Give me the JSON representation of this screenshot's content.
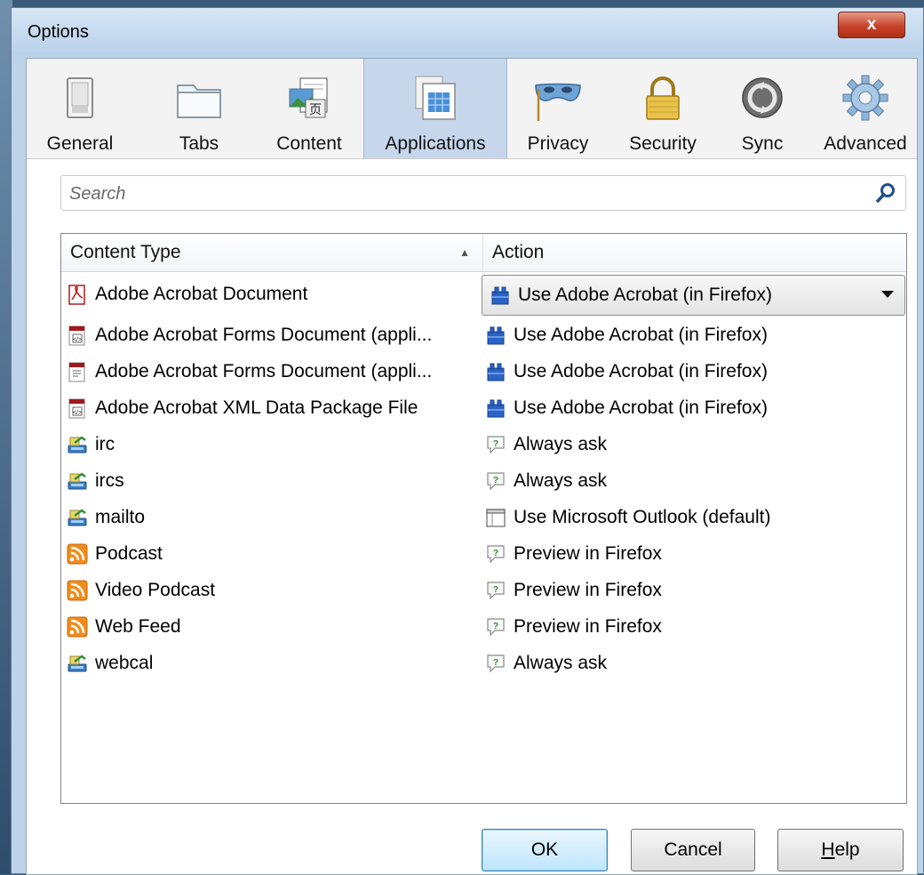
{
  "window": {
    "title": "Options",
    "close_label": "x"
  },
  "toolbar": {
    "items": [
      {
        "label": "General",
        "icon": "switch-icon"
      },
      {
        "label": "Tabs",
        "icon": "folder-tabs-icon"
      },
      {
        "label": "Content",
        "icon": "content-icon"
      },
      {
        "label": "Applications",
        "icon": "applications-icon",
        "selected": true
      },
      {
        "label": "Privacy",
        "icon": "mask-icon"
      },
      {
        "label": "Security",
        "icon": "padlock-icon"
      },
      {
        "label": "Sync",
        "icon": "sync-icon"
      },
      {
        "label": "Advanced",
        "icon": "gear-icon"
      }
    ]
  },
  "search": {
    "placeholder": "Search",
    "value": ""
  },
  "table": {
    "columns": {
      "content_type": "Content Type",
      "action": "Action"
    },
    "rows": [
      {
        "type": "Adobe Acrobat Document",
        "type_icon": "pdf-icon",
        "action": "Use Adobe Acrobat (in Firefox)",
        "action_icon": "acrobat-plugin-icon",
        "selected": true
      },
      {
        "type": "Adobe Acrobat Forms Document (appli...",
        "type_icon": "acrobat-forms-icon",
        "action": "Use Adobe Acrobat (in Firefox)",
        "action_icon": "acrobat-plugin-icon"
      },
      {
        "type": "Adobe Acrobat Forms Document (appli...",
        "type_icon": "acrobat-forms-doc-icon",
        "action": "Use Adobe Acrobat (in Firefox)",
        "action_icon": "acrobat-plugin-icon"
      },
      {
        "type": "Adobe Acrobat XML Data Package File",
        "type_icon": "acrobat-xml-icon",
        "action": "Use Adobe Acrobat (in Firefox)",
        "action_icon": "acrobat-plugin-icon"
      },
      {
        "type": "irc",
        "type_icon": "protocol-icon",
        "action": "Always ask",
        "action_icon": "ask-icon"
      },
      {
        "type": "ircs",
        "type_icon": "protocol-icon",
        "action": "Always ask",
        "action_icon": "ask-icon"
      },
      {
        "type": "mailto",
        "type_icon": "protocol-icon",
        "action": "Use Microsoft Outlook (default)",
        "action_icon": "application-icon"
      },
      {
        "type": "Podcast",
        "type_icon": "feed-icon",
        "action": "Preview in Firefox",
        "action_icon": "ask-icon"
      },
      {
        "type": "Video Podcast",
        "type_icon": "feed-icon",
        "action": "Preview in Firefox",
        "action_icon": "ask-icon"
      },
      {
        "type": "Web Feed",
        "type_icon": "feed-icon",
        "action": "Preview in Firefox",
        "action_icon": "ask-icon"
      },
      {
        "type": "webcal",
        "type_icon": "protocol-icon",
        "action": "Always ask",
        "action_icon": "ask-icon"
      }
    ]
  },
  "buttons": {
    "ok": "OK",
    "cancel": "Cancel",
    "help_mnemonic": "H",
    "help_rest": "elp"
  },
  "colors": {
    "selected_tab": "#c6d7ec",
    "close_button": "#c7442a",
    "ok_border": "#3c7fb1"
  }
}
